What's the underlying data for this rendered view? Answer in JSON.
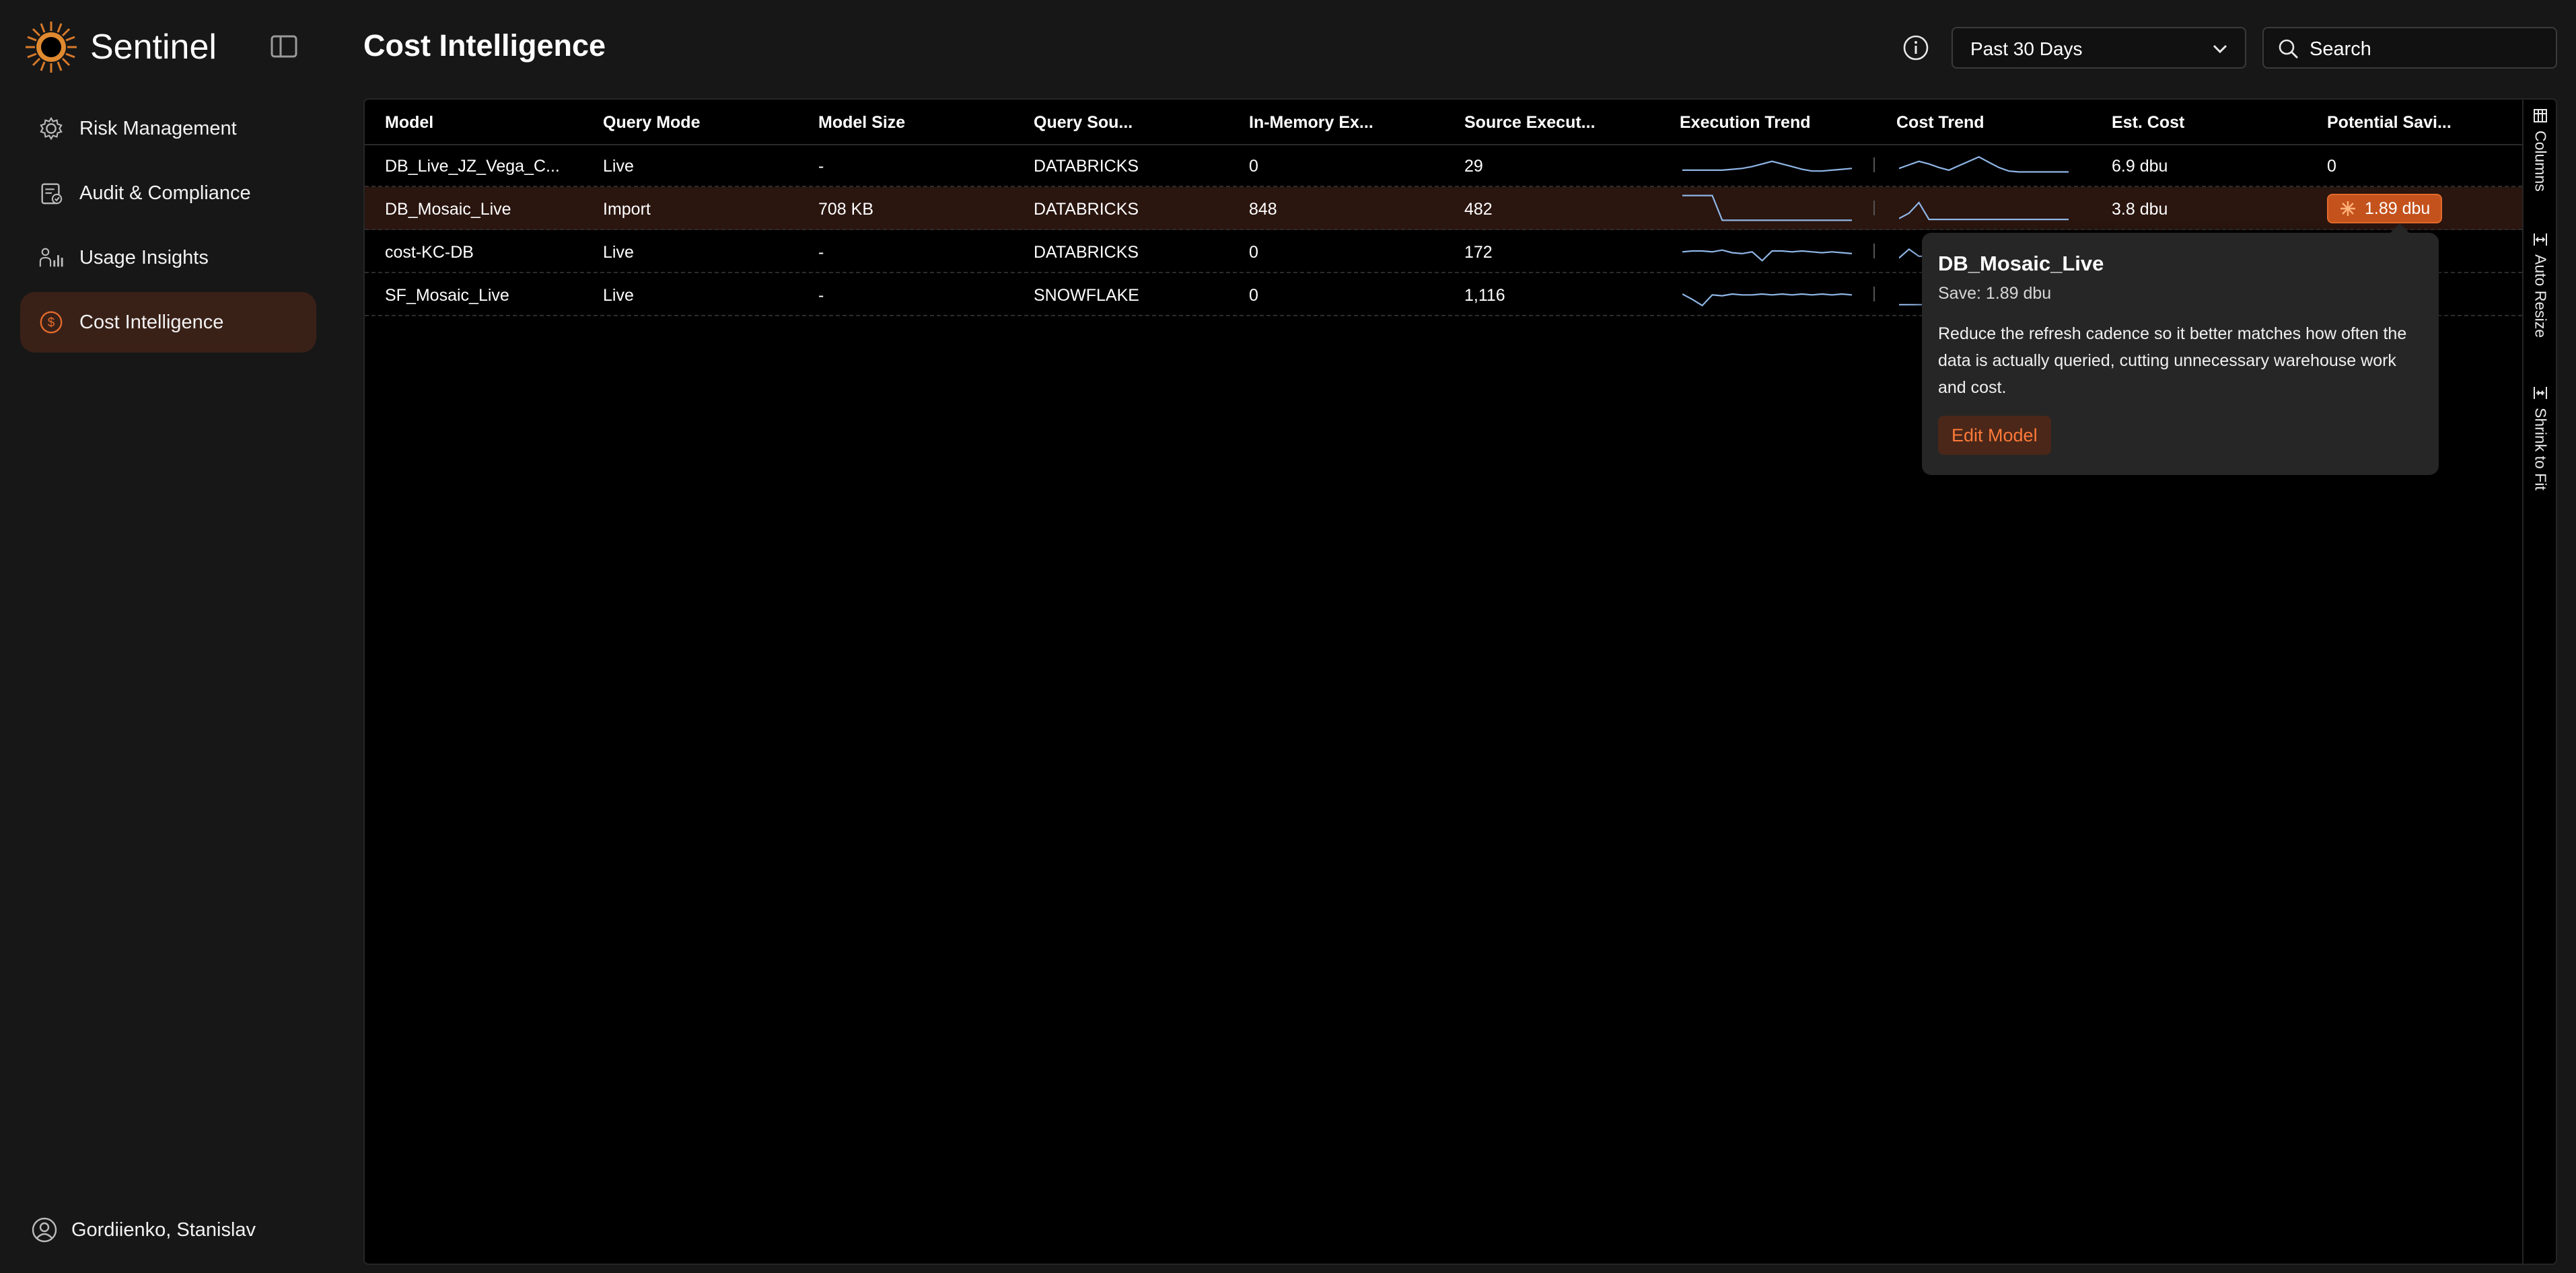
{
  "app": {
    "name": "Sentinel"
  },
  "sidebar": {
    "items": [
      {
        "label": "Risk Management",
        "icon": "gear-icon",
        "active": false
      },
      {
        "label": "Audit & Compliance",
        "icon": "clipboard-check-icon",
        "active": false
      },
      {
        "label": "Usage Insights",
        "icon": "people-chart-icon",
        "active": false
      },
      {
        "label": "Cost Intelligence",
        "icon": "dollar-circle-icon",
        "active": true
      }
    ],
    "user": {
      "name": "Gordiienko, Stanislav"
    }
  },
  "header": {
    "title": "Cost Intelligence",
    "date_range": "Past 30 Days",
    "search_placeholder": "Search"
  },
  "table": {
    "columns": [
      "Model",
      "Query Mode",
      "Model Size",
      "Query Sou...",
      "In-Memory Ex...",
      "Source Execut...",
      "Execution Trend",
      "Cost Trend",
      "Est. Cost",
      "Potential Savi..."
    ],
    "rows": [
      {
        "model": "DB_Live_JZ_Vega_C...",
        "query_mode": "Live",
        "model_size": "-",
        "query_source": "DATABRICKS",
        "in_memory": "0",
        "source_exec": "29",
        "est_cost": "6.9 dbu",
        "savings": "0",
        "savings_badge": false,
        "exec_trend": [
          10,
          10,
          10,
          10,
          10,
          11,
          12,
          14,
          17,
          20,
          17,
          14,
          11,
          9,
          9,
          10,
          11,
          12
        ],
        "cost_trend": [
          12,
          16,
          20,
          17,
          13,
          10,
          15,
          20,
          25,
          19,
          13,
          9,
          8,
          8,
          8,
          8,
          8,
          8
        ]
      },
      {
        "model": "DB_Mosaic_Live",
        "query_mode": "Import",
        "model_size": "708 KB",
        "query_source": "DATABRICKS",
        "in_memory": "848",
        "source_exec": "482",
        "est_cost": "3.8 dbu",
        "savings": "1.89 dbu",
        "savings_badge": true,
        "exec_trend": [
          30,
          30,
          30,
          30,
          2,
          2,
          2,
          2,
          2,
          2,
          2,
          2,
          2,
          2,
          2,
          2,
          2,
          2
        ],
        "cost_trend": [
          4,
          10,
          22,
          3,
          3,
          3,
          3,
          3,
          3,
          3,
          3,
          3,
          3,
          3,
          3,
          3,
          3,
          3
        ]
      },
      {
        "model": "cost-KC-DB",
        "query_mode": "Live",
        "model_size": "-",
        "query_source": "DATABRICKS",
        "in_memory": "0",
        "source_exec": "172",
        "est_cost": "",
        "savings": "",
        "savings_badge": false,
        "exec_trend": [
          15,
          16,
          16,
          15,
          17,
          14,
          13,
          15,
          5,
          16,
          16,
          15,
          16,
          15,
          14,
          15,
          14,
          13
        ],
        "cost_trend": [
          8,
          18,
          10,
          10,
          10,
          10,
          10,
          10,
          10,
          10,
          10,
          10,
          10,
          10,
          10,
          10,
          10,
          10
        ]
      },
      {
        "model": "SF_Mosaic_Live",
        "query_mode": "Live",
        "model_size": "-",
        "query_source": "SNOWFLAKE",
        "in_memory": "0",
        "source_exec": "1,116",
        "est_cost": "",
        "savings": "",
        "savings_badge": false,
        "exec_trend": [
          16,
          10,
          3,
          15,
          14,
          16,
          15,
          15,
          16,
          15,
          16,
          15,
          16,
          15,
          16,
          15,
          16,
          15
        ],
        "cost_trend": [
          4,
          4,
          4,
          4,
          4,
          4,
          4,
          4,
          4,
          4,
          4,
          4,
          4,
          4,
          4,
          4,
          4,
          4
        ]
      }
    ]
  },
  "tool_panel": {
    "items": [
      {
        "label": "Columns",
        "icon": "columns-icon"
      },
      {
        "label": "Auto Resize",
        "icon": "auto-resize-icon"
      },
      {
        "label": "Shrink to Fit",
        "icon": "shrink-to-fit-icon"
      }
    ]
  },
  "popover": {
    "title": "DB_Mosaic_Live",
    "subtitle": "Save: 1.89 dbu",
    "body": "Reduce the refresh cadence so it better matches how often the data is actually queried, cutting unnecessary warehouse work and cost.",
    "button": "Edit Model"
  },
  "colors": {
    "accent": "#e26a2c",
    "accent_dark": "#c4521c",
    "active_bg": "#3a2118",
    "spark": "#8fb6e6"
  }
}
